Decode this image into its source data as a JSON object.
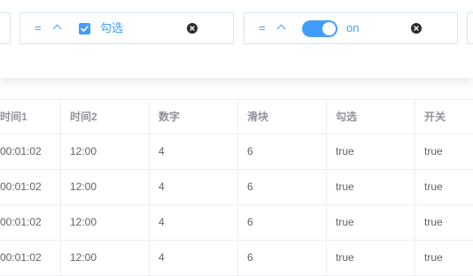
{
  "filters": {
    "checkbox_filter": {
      "operator": "=",
      "checked": true,
      "label": "勾选"
    },
    "switch_filter": {
      "operator": "=",
      "state": true,
      "label": "on"
    }
  },
  "table": {
    "columns": [
      "时间1",
      "时间2",
      "数字",
      "滑块",
      "勾选",
      "开关"
    ],
    "rows": [
      [
        "00:01:02",
        "12:00",
        "4",
        "6",
        "true",
        "true"
      ],
      [
        "00:01:02",
        "12:00",
        "4",
        "6",
        "true",
        "true"
      ],
      [
        "00:01:02",
        "12:00",
        "4",
        "6",
        "true",
        "true"
      ],
      [
        "00:01:02",
        "12:00",
        "4",
        "6",
        "true",
        "true"
      ]
    ]
  },
  "colors": {
    "accent": "#409eff",
    "border": "#ebeef5",
    "chip_border": "#d5e8ee",
    "header_text": "#909399",
    "cell_text": "#606266"
  },
  "icons": {
    "chevron": "chevron-up-icon",
    "clear": "clear-circle-x-icon",
    "check": "checkmark-icon"
  }
}
